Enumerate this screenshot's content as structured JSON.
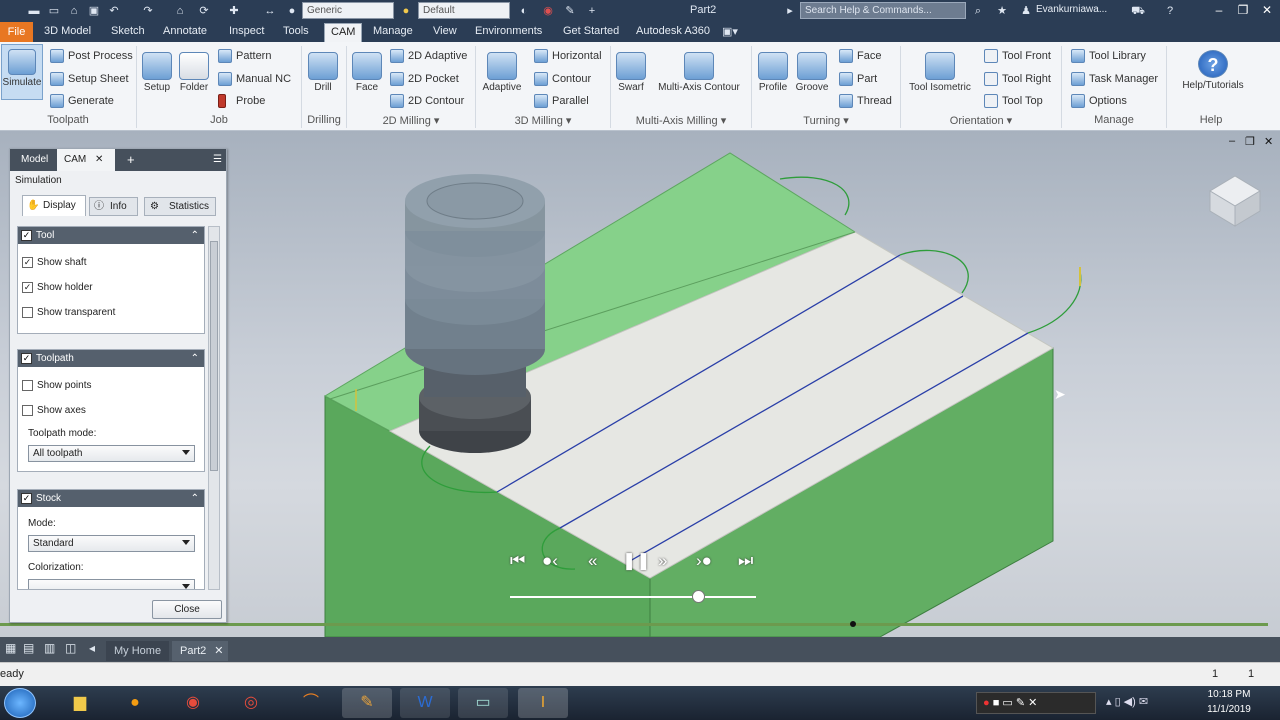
{
  "titlebar": {
    "material": "Generic",
    "appearance": "Default",
    "document": "Part2",
    "search_placeholder": "Search Help & Commands...",
    "user": "Evankurniawa..."
  },
  "menu": {
    "items": [
      "File",
      "3D Model",
      "Sketch",
      "Annotate",
      "Inspect",
      "Tools",
      "CAM",
      "Manage",
      "View",
      "Environments",
      "Get Started",
      "Autodesk A360"
    ],
    "active": "CAM"
  },
  "ribbon": {
    "toolpath": {
      "simulate": "Simulate",
      "post_process": "Post Process",
      "setup_sheet": "Setup Sheet",
      "generate": "Generate",
      "group": "Toolpath"
    },
    "job": {
      "setup": "Setup",
      "folder": "Folder",
      "pattern": "Pattern",
      "manual_nc": "Manual NC",
      "probe": "Probe",
      "group": "Job"
    },
    "drilling": {
      "drill": "Drill",
      "group": "Drilling"
    },
    "milling2d": {
      "face": "Face",
      "adaptive": "2D Adaptive",
      "pocket": "2D Pocket",
      "contour": "2D Contour",
      "group": "2D Milling ▾"
    },
    "milling3d": {
      "adaptive": "Adaptive",
      "horizontal": "Horizontal",
      "contour": "Contour",
      "parallel": "Parallel",
      "group": "3D Milling ▾"
    },
    "multiaxis": {
      "swarf": "Swarf",
      "contour": "Multi-Axis Contour",
      "group": "Multi-Axis Milling ▾"
    },
    "turning": {
      "profile": "Profile",
      "groove": "Groove",
      "face": "Face",
      "part": "Part",
      "thread": "Thread",
      "group": "Turning ▾"
    },
    "orientation": {
      "isometric": "Tool Isometric",
      "front": "Tool Front",
      "right": "Tool Right",
      "top": "Tool Top",
      "group": "Orientation ▾"
    },
    "manage": {
      "library": "Tool Library",
      "task": "Task Manager",
      "options": "Options",
      "group": "Manage"
    },
    "help": {
      "label": "Help/Tutorials",
      "group": "Help"
    }
  },
  "panel": {
    "tabs": [
      "Model",
      "CAM"
    ],
    "title": "Simulation",
    "subtabs": [
      "Display",
      "Info",
      "Statistics"
    ],
    "tool": {
      "header": "Tool",
      "show_shaft": "Show shaft",
      "show_holder": "Show holder",
      "show_transparent": "Show transparent"
    },
    "toolpath": {
      "header": "Toolpath",
      "show_points": "Show points",
      "show_axes": "Show axes",
      "mode_label": "Toolpath mode:",
      "mode_value": "All toolpath"
    },
    "stock": {
      "header": "Stock",
      "mode_label": "Mode:",
      "mode_value": "Standard",
      "color_label": "Colorization:"
    },
    "close": "Close"
  },
  "docbar": {
    "tabs": [
      "My Home",
      "Part2"
    ]
  },
  "status": {
    "text": "eady",
    "num1": "1",
    "num2": "1"
  },
  "clock": {
    "time": "10:18 PM",
    "date": "11/1/2019"
  },
  "colors": {
    "accent": "#e87722",
    "stock_green": "#79c47a",
    "toolpath_blue": "#2a3fa8"
  }
}
